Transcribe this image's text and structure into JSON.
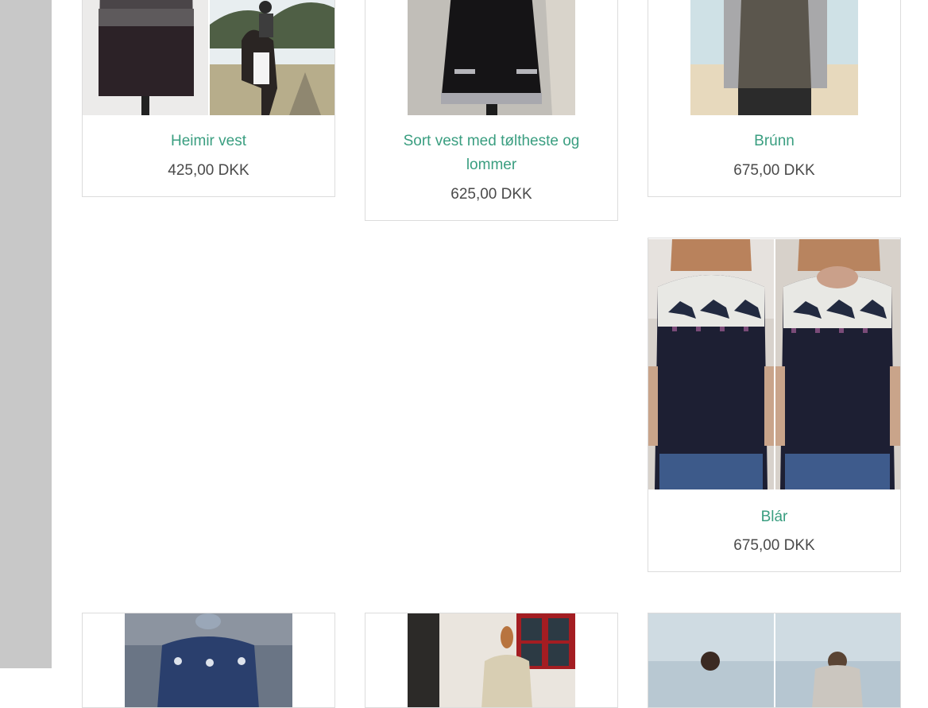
{
  "products": [
    {
      "name": "Heimir vest",
      "price": "425,00 DKK"
    },
    {
      "name": "Sort vest med tøltheste og lommer",
      "price": "625,00 DKK"
    },
    {
      "name": "Brúnn",
      "price": "675,00 DKK"
    },
    {
      "name": "Blár",
      "price": "675,00 DKK"
    }
  ],
  "colors": {
    "title": "#3a9e80",
    "price": "#4a4a4a",
    "sidebar": "#c8c8c8",
    "border": "#dcdcdc"
  }
}
